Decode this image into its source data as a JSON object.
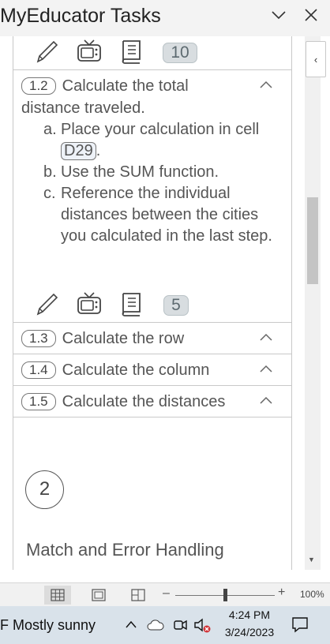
{
  "window": {
    "title": "MyEducator Tasks"
  },
  "task_1_1": {
    "count": "10"
  },
  "task_1_2": {
    "number": "1.2",
    "title": "Calculate the total",
    "description_rest": "distance traveled.",
    "steps": [
      {
        "label": "a.",
        "text_before": "Place your calculation in cell",
        "cell": "D29",
        "text_after": "."
      },
      {
        "label": "b.",
        "text": "Use the SUM function."
      },
      {
        "label": "c.",
        "text": "Reference the individual distances between the cities you calculated in the last step."
      }
    ],
    "count": "5"
  },
  "tasks": [
    {
      "number": "1.3",
      "title": "Calculate the row"
    },
    {
      "number": "1.4",
      "title": "Calculate the column"
    },
    {
      "number": "1.5",
      "title": "Calculate the distances"
    }
  ],
  "section": {
    "number": "2",
    "title": "Match and Error Handling"
  },
  "statusbar": {
    "zoom": "100%"
  },
  "taskbar": {
    "weather": "F  Mostly sunny",
    "time": "4:24 PM",
    "date": "3/24/2023"
  }
}
